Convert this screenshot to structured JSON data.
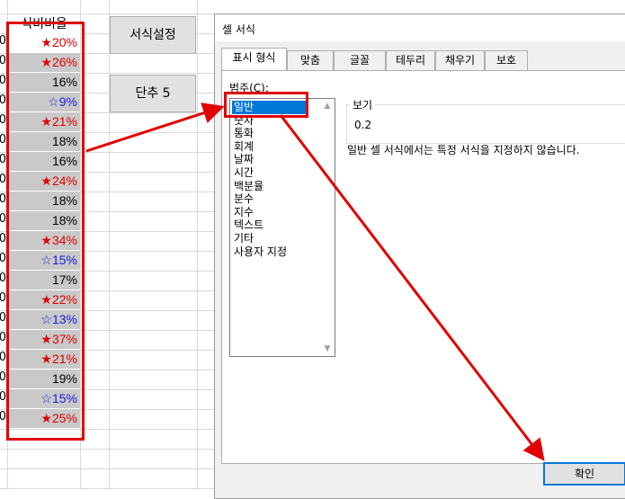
{
  "sheet": {
    "column_header": "식비비율",
    "left_digit": "0",
    "cells": [
      {
        "text": "★20%",
        "color": "red"
      },
      {
        "text": "★26%",
        "color": "red"
      },
      {
        "text": "16%",
        "color": "black"
      },
      {
        "text": "☆9%",
        "color": "blue"
      },
      {
        "text": "★21%",
        "color": "red"
      },
      {
        "text": "18%",
        "color": "black"
      },
      {
        "text": "16%",
        "color": "black"
      },
      {
        "text": "★24%",
        "color": "red"
      },
      {
        "text": "18%",
        "color": "black"
      },
      {
        "text": "18%",
        "color": "black"
      },
      {
        "text": "★34%",
        "color": "red"
      },
      {
        "text": "☆15%",
        "color": "blue"
      },
      {
        "text": "17%",
        "color": "black"
      },
      {
        "text": "★22%",
        "color": "red"
      },
      {
        "text": "☆13%",
        "color": "blue"
      },
      {
        "text": "★37%",
        "color": "red"
      },
      {
        "text": "★21%",
        "color": "red"
      },
      {
        "text": "19%",
        "color": "black"
      },
      {
        "text": "☆15%",
        "color": "blue"
      },
      {
        "text": "★25%",
        "color": "red"
      }
    ],
    "buttons": {
      "format_settings": "서식설정",
      "shortcut": "단추 5"
    }
  },
  "dialog": {
    "title": "셀 서식",
    "tabs": [
      "표시 형식",
      "맞춤",
      "글꼴",
      "테두리",
      "채우기",
      "보호"
    ],
    "active_tab": "표시 형식",
    "category_label": "범주(C):",
    "categories": [
      "일반",
      "숫자",
      "통화",
      "회계",
      "날짜",
      "시간",
      "백분율",
      "분수",
      "지수",
      "텍스트",
      "기타",
      "사용자 지정"
    ],
    "selected_category": "일반",
    "preview_label": "보기",
    "preview_value": "0.2",
    "description": "일반 셀 서식에서는 특정 서식을 지정하지 않습니다.",
    "ok_button": "확인"
  },
  "colors": {
    "highlight": "#e00000",
    "star_red": "#e00000",
    "star_blue": "#1a1adb",
    "selection": "#0078d7",
    "cell_fill": "#c9c9c9"
  }
}
